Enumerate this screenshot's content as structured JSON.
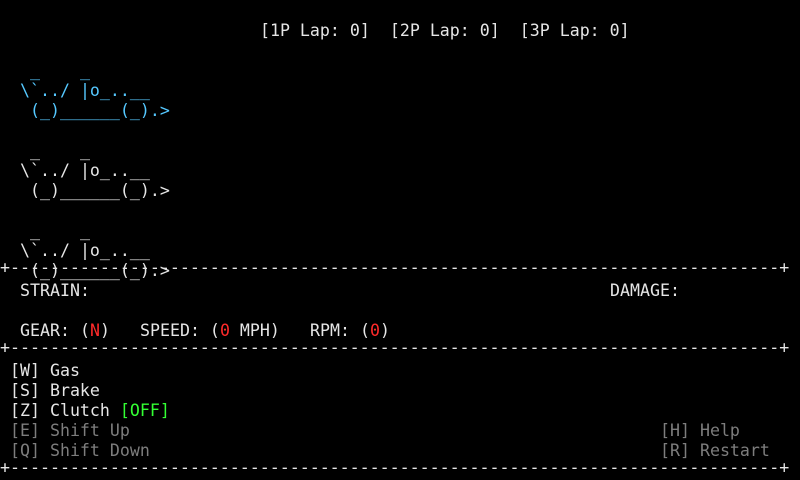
{
  "header": {
    "laps": [
      {
        "label": "[1P Lap: 0]"
      },
      {
        "label": "[2P Lap: 0]"
      },
      {
        "label": "[3P Lap: 0]"
      }
    ]
  },
  "cars": [
    {
      "art": " _    _\n\\`../ |o_..__\n (_)______(_).>",
      "color": "#55c8ff"
    },
    {
      "art": " _    _\n\\`../ |o_..__\n (_)______(_).>",
      "color": "#e6e6e6"
    },
    {
      "art": " _    _\n\\`../ |o_..__\n (_)______(_).>",
      "color": "#e6e6e6"
    }
  ],
  "divider": "+-----------------------------------------------------------------------------+",
  "status": {
    "strain_label": "STRAIN:",
    "damage_label": "DAMAGE:"
  },
  "gauges": {
    "gear_label": "GEAR: (",
    "gear_value": "N",
    "gear_close": ")",
    "speed_label": "SPEED: (",
    "speed_value": "0",
    "speed_unit": " MPH)",
    "rpm_label": "RPM: (",
    "rpm_value": "0",
    "rpm_close": ")"
  },
  "controls": {
    "gas": "[W] Gas",
    "brake": "[S] Brake",
    "clutch": "[Z] Clutch",
    "clutch_state": "[OFF]",
    "shift_up": "[E] Shift Up",
    "shift_down": "[Q] Shift Down",
    "help": "[H] Help",
    "restart": "[R] Restart"
  },
  "colors": {
    "background": "#000000",
    "text": "#e6e6e6",
    "player1": "#55c8ff",
    "value": "#ff2a2a",
    "on_off": "#33ff33",
    "disabled": "#7d7d7d"
  }
}
